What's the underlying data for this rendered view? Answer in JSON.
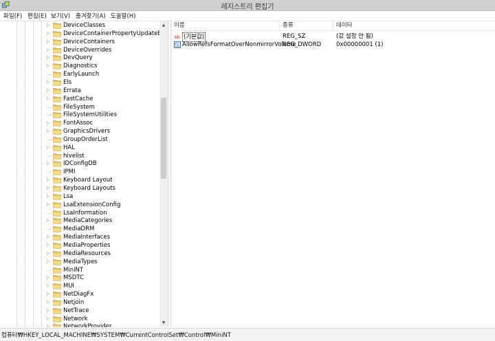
{
  "window": {
    "title": "레지스트리 편집기"
  },
  "menu": [
    {
      "label": "파일(F)"
    },
    {
      "label": "편집(E)"
    },
    {
      "label": "보기(V)"
    },
    {
      "label": "즐겨찾기(A)"
    },
    {
      "label": "도움말(H)"
    }
  ],
  "tree": {
    "items": [
      {
        "label": "DeviceClasses",
        "expandable": true
      },
      {
        "label": "DeviceContainerPropertyUpdateEvents",
        "expandable": true
      },
      {
        "label": "DeviceContainers",
        "expandable": true
      },
      {
        "label": "DeviceOverrides",
        "expandable": true
      },
      {
        "label": "DevQuery",
        "expandable": true
      },
      {
        "label": "Diagnostics",
        "expandable": true
      },
      {
        "label": "EarlyLaunch",
        "expandable": false
      },
      {
        "label": "Els",
        "expandable": true
      },
      {
        "label": "Errata",
        "expandable": true
      },
      {
        "label": "FastCache",
        "expandable": true
      },
      {
        "label": "FileSystem",
        "expandable": false
      },
      {
        "label": "FileSystemUtilities",
        "expandable": false
      },
      {
        "label": "FontAssoc",
        "expandable": true
      },
      {
        "label": "GraphicsDrivers",
        "expandable": true
      },
      {
        "label": "GroupOrderList",
        "expandable": false
      },
      {
        "label": "HAL",
        "expandable": true
      },
      {
        "label": "hivelist",
        "expandable": false
      },
      {
        "label": "IDConfigDB",
        "expandable": true
      },
      {
        "label": "IPMI",
        "expandable": false
      },
      {
        "label": "Keyboard Layout",
        "expandable": true
      },
      {
        "label": "Keyboard Layouts",
        "expandable": true
      },
      {
        "label": "Lsa",
        "expandable": true
      },
      {
        "label": "LsaExtensionConfig",
        "expandable": true
      },
      {
        "label": "LsaInformation",
        "expandable": false
      },
      {
        "label": "MediaCategories",
        "expandable": true
      },
      {
        "label": "MediaDRM",
        "expandable": false
      },
      {
        "label": "MediaInterfaces",
        "expandable": true
      },
      {
        "label": "MediaProperties",
        "expandable": true
      },
      {
        "label": "MediaResources",
        "expandable": true
      },
      {
        "label": "MediaTypes",
        "expandable": true
      },
      {
        "label": "MiniNT",
        "expandable": false
      },
      {
        "label": "MSDTC",
        "expandable": true
      },
      {
        "label": "MUI",
        "expandable": true
      },
      {
        "label": "NetDiagFx",
        "expandable": true
      },
      {
        "label": "Netjoin",
        "expandable": true
      },
      {
        "label": "NetTrace",
        "expandable": true
      },
      {
        "label": "Network",
        "expandable": true
      },
      {
        "label": "NetworkProvider",
        "expandable": true
      }
    ]
  },
  "list": {
    "columns": [
      "이름",
      "종류",
      "데이터"
    ],
    "rows": [
      {
        "icon": "string-value-icon",
        "name": "(기본값)",
        "type": "REG_SZ",
        "data": "(값 설정 안 됨)"
      },
      {
        "icon": "dword-value-icon",
        "name": "AllowRefsFormatOverNonmirrorVolume",
        "type": "REG_DWORD",
        "data": "0x00000001 (1)"
      }
    ]
  },
  "status": {
    "path": "컴퓨터₩HKEY_LOCAL_MACHINE₩SYSTEM₩CurrentControlSet₩Control₩MiniNT"
  },
  "colors": {
    "folder": "#e8c25a",
    "accent": "#1e5aa8"
  }
}
